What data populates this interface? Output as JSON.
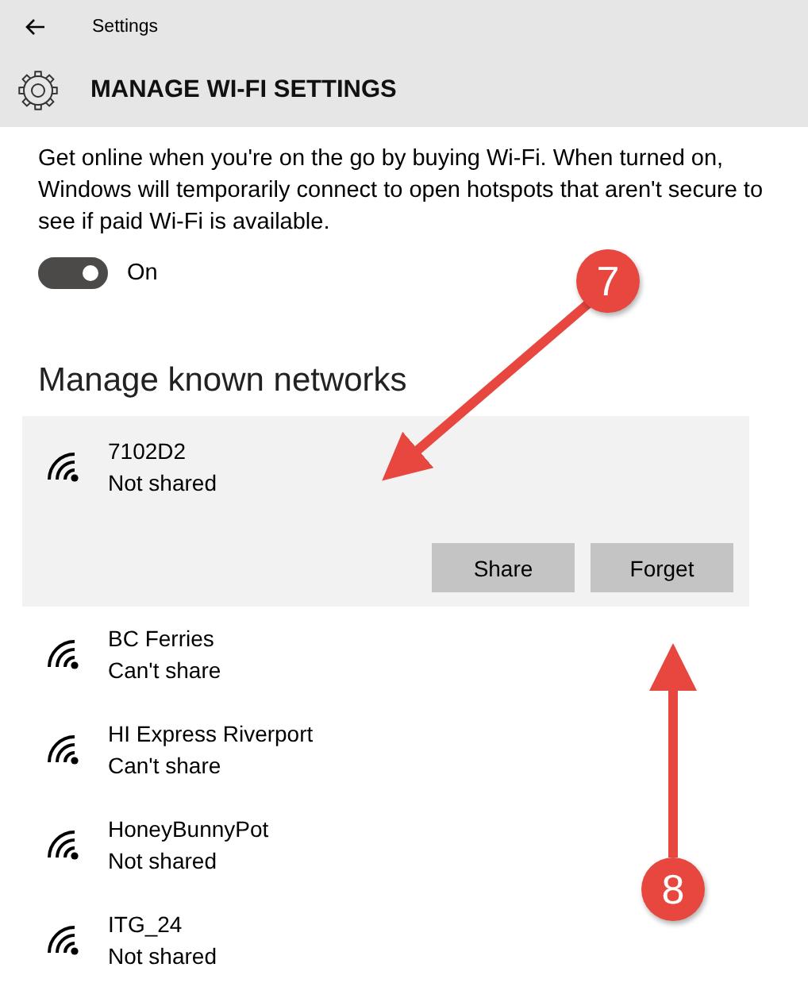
{
  "window": {
    "title": "Settings"
  },
  "header": {
    "title": "MANAGE WI-FI SETTINGS"
  },
  "description": "Get online when you're on the go by buying Wi-Fi. When turned on, Windows will temporarily connect to open hotspots that aren't secure to see if paid Wi-Fi is available.",
  "toggle": {
    "on": true,
    "label": "On"
  },
  "section_title": "Manage known networks",
  "networks": [
    {
      "name": "7102D2",
      "status": "Not shared",
      "selected": true,
      "actions": [
        "Share",
        "Forget"
      ]
    },
    {
      "name": "BC Ferries",
      "status": "Can't share",
      "selected": false
    },
    {
      "name": "HI Express Riverport",
      "status": "Can't share",
      "selected": false
    },
    {
      "name": "HoneyBunnyPot",
      "status": "Not shared",
      "selected": false
    },
    {
      "name": "ITG_24",
      "status": "Not shared",
      "selected": false
    }
  ],
  "annotations": [
    {
      "label": "7"
    },
    {
      "label": "8"
    }
  ]
}
